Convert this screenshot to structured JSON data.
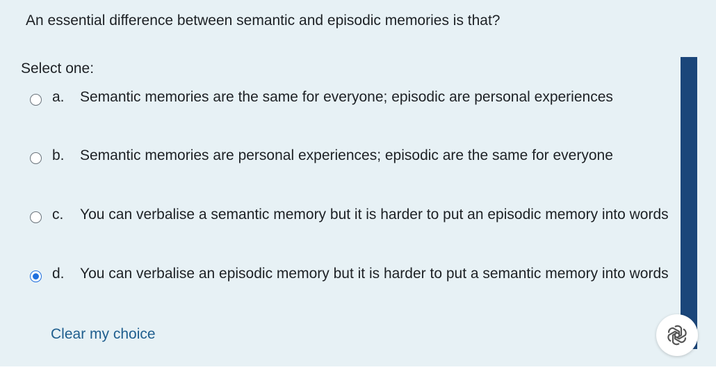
{
  "question": {
    "text": "An essential difference between semantic and episodic memories is that?"
  },
  "prompt": "Select one:",
  "options": [
    {
      "letter": "a.",
      "text": "Semantic memories are the same for everyone; episodic are personal experiences",
      "selected": false
    },
    {
      "letter": "b.",
      "text": "Semantic memories are personal experiences; episodic are the same for everyone",
      "selected": false
    },
    {
      "letter": "c.",
      "text": "You can verbalise a semantic memory but it is harder to put an episodic memory into words",
      "selected": false
    },
    {
      "letter": "d.",
      "text": "You can verbalise an episodic memory but it is harder to put a semantic memory into words",
      "selected": true
    }
  ],
  "clear_choice_label": "Clear my choice",
  "colors": {
    "panel_background": "#e7f1f5",
    "text": "#1d2125",
    "link": "#1f5e8e",
    "radio_selected": "#1f6fde",
    "scrollbar": "#1b467a"
  },
  "assistant_icon": "openai-logo-icon"
}
